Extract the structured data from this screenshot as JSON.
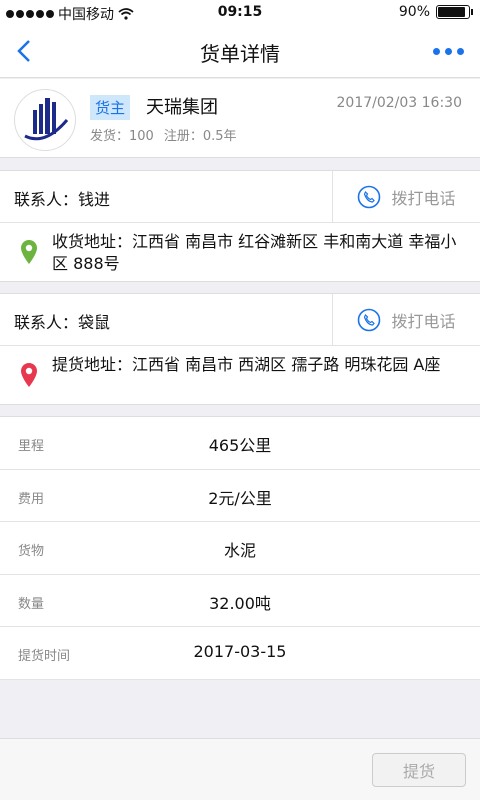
{
  "status_bar": {
    "carrier": "中国移动",
    "time": "09:15",
    "battery_text": "90%",
    "battery_level": 0.9
  },
  "navbar": {
    "title": "货单详情"
  },
  "shipper": {
    "tag": "货主",
    "company": "天瑞集团",
    "timestamp": "2017/02/03 16:30",
    "shipments": "发货：100",
    "registered": "注册：0.5年"
  },
  "contact1": {
    "label": "联系人：钱进",
    "call_label": "拨打电话",
    "address": "收货地址：江西省 南昌市 红谷滩新区 丰和南大道 幸福小区 888号",
    "pin_color": "#6db33f"
  },
  "contact2": {
    "label": "联系人：袋鼠",
    "call_label": "拨打电话",
    "address": "提货地址：江西省 南昌市 西湖区 孺子路 明珠花园 A座",
    "pin_color": "#e8384f"
  },
  "details": [
    {
      "key": "里程",
      "value": "465公里"
    },
    {
      "key": "费用",
      "value": "2元/公里"
    },
    {
      "key": "货物",
      "value": "水泥"
    },
    {
      "key": "数量",
      "value": "32.00吨"
    },
    {
      "key": "提货时间",
      "value": "2017-03-15"
    }
  ],
  "bottom": {
    "pickup_label": "提货"
  },
  "colors": {
    "accent": "#1a73e8",
    "tag_bg": "#cfe7fb"
  }
}
